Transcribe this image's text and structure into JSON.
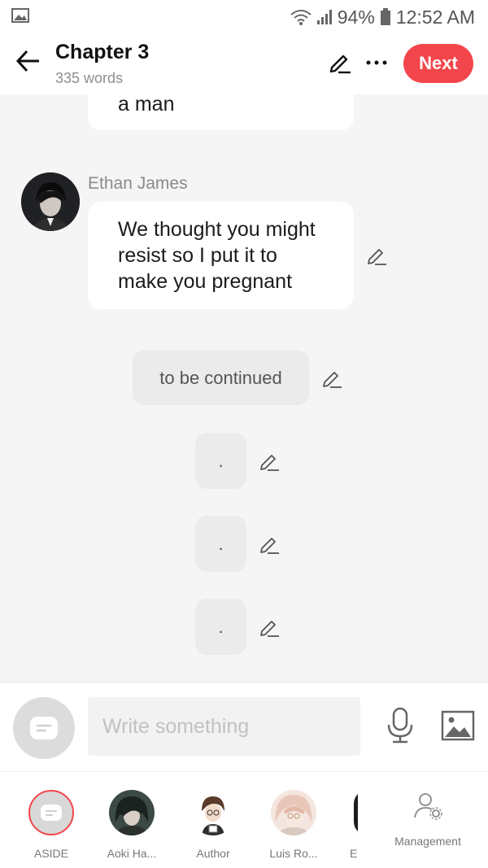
{
  "status_bar": {
    "battery": "94%",
    "time": "12:52 AM"
  },
  "header": {
    "title": "Chapter 3",
    "word_count": "335 words",
    "next_label": "Next"
  },
  "messages": {
    "top_bubble_text": "a man",
    "sender_name": "Ethan James",
    "main_bubble_lines": [
      "We thought you might",
      "resist so I put it to",
      "make you pregnant"
    ],
    "narration": "to be continued",
    "dots": [
      ".",
      ".",
      "."
    ]
  },
  "composer": {
    "placeholder": "Write something"
  },
  "characters": [
    {
      "label": "ASIDE"
    },
    {
      "label": "Aoki Ha..."
    },
    {
      "label": "Author"
    },
    {
      "label": "Luis Ro..."
    },
    {
      "label": "Eth"
    }
  ],
  "management_label": "Management",
  "colors": {
    "accent": "#f2464c",
    "background": "#f5f5f5"
  }
}
